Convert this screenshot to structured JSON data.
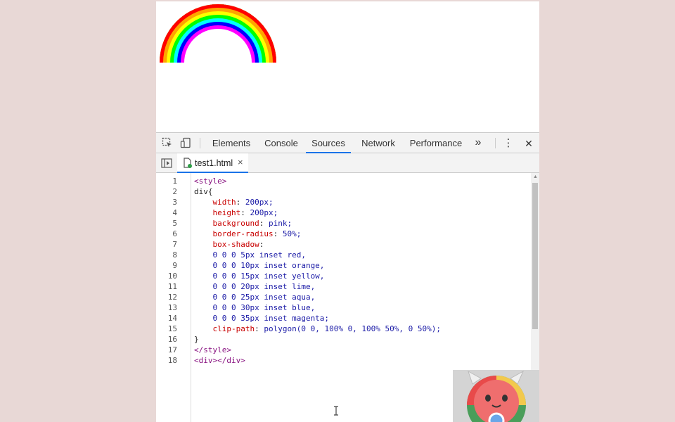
{
  "devtools": {
    "tabs": [
      {
        "label": "Elements",
        "active": false
      },
      {
        "label": "Console",
        "active": false
      },
      {
        "label": "Sources",
        "active": true
      },
      {
        "label": "Network",
        "active": false
      },
      {
        "label": "Performance",
        "active": false
      }
    ],
    "more_tabs_label": "»",
    "menu_label": "⋮",
    "close_label": "✕",
    "file_tab": {
      "name": "test1.html",
      "close": "×"
    }
  },
  "editor": {
    "line_numbers": [
      "1",
      "2",
      "3",
      "4",
      "5",
      "6",
      "7",
      "8",
      "9",
      "10",
      "11",
      "12",
      "13",
      "14",
      "15",
      "16",
      "17",
      "18"
    ],
    "lines": [
      "<style>",
      "div{",
      "    width: 200px;",
      "    height: 200px;",
      "    background: pink;",
      "    border-radius: 50%;",
      "    box-shadow:",
      "    0 0 0 5px inset red,",
      "    0 0 0 10px inset orange,",
      "    0 0 0 15px inset yellow,",
      "    0 0 0 20px inset lime,",
      "    0 0 0 25px inset aqua,",
      "    0 0 0 30px inset blue,",
      "    0 0 0 35px inset magenta;",
      "    clip-path: polygon(0 0, 100% 0, 100% 50%, 0 50%);",
      "}",
      "</style>",
      "<div></div>"
    ]
  },
  "colors": {
    "page_background": "#e8d8d6",
    "active_tab_underline": "#1a73e8",
    "tag_color": "#881280",
    "property_color": "#c80000",
    "value_color": "#1a1aa6"
  },
  "icons": [
    "inspect-element-icon",
    "device-toolbar-icon",
    "more-tabs-icon",
    "menu-dots-icon",
    "close-icon",
    "navigator-toggle-icon",
    "file-icon",
    "text-cursor-icon",
    "mascot-icon"
  ]
}
